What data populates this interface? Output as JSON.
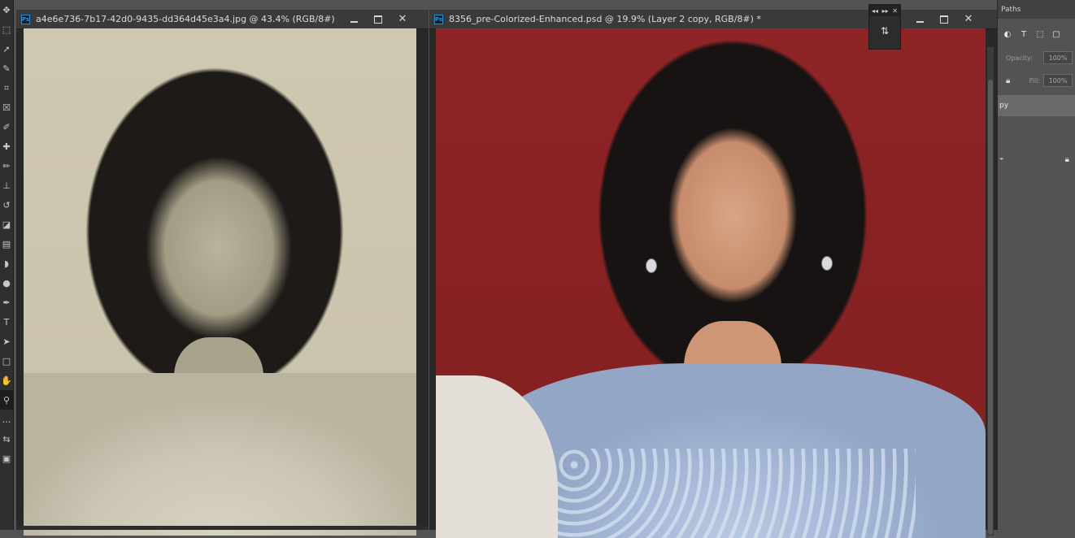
{
  "toolbar": {
    "tools": [
      {
        "name": "move-tool-icon",
        "glyph": "✥"
      },
      {
        "name": "marquee-tool-icon",
        "glyph": "⬚"
      },
      {
        "name": "lasso-tool-icon",
        "glyph": "➚"
      },
      {
        "name": "quick-select-tool-icon",
        "glyph": "✎"
      },
      {
        "name": "crop-tool-icon",
        "glyph": "⌗"
      },
      {
        "name": "frame-tool-icon",
        "glyph": "☒"
      },
      {
        "name": "eyedropper-tool-icon",
        "glyph": "✐"
      },
      {
        "name": "healing-brush-tool-icon",
        "glyph": "✚"
      },
      {
        "name": "brush-tool-icon",
        "glyph": "✏"
      },
      {
        "name": "clone-stamp-tool-icon",
        "glyph": "⊥"
      },
      {
        "name": "history-brush-tool-icon",
        "glyph": "↺"
      },
      {
        "name": "eraser-tool-icon",
        "glyph": "◪"
      },
      {
        "name": "gradient-tool-icon",
        "glyph": "▤"
      },
      {
        "name": "blur-tool-icon",
        "glyph": "◗"
      },
      {
        "name": "dodge-tool-icon",
        "glyph": "●"
      },
      {
        "name": "pen-tool-icon",
        "glyph": "✒"
      },
      {
        "name": "type-tool-icon",
        "glyph": "T"
      },
      {
        "name": "path-select-tool-icon",
        "glyph": "➤"
      },
      {
        "name": "shape-tool-icon",
        "glyph": "□"
      },
      {
        "name": "hand-tool-icon",
        "glyph": "✋"
      },
      {
        "name": "zoom-tool-icon",
        "glyph": "⚲"
      },
      {
        "name": "more-tools-icon",
        "glyph": "…"
      },
      {
        "name": "swap-colors-icon",
        "glyph": "⇆"
      },
      {
        "name": "color-swatches-icon",
        "glyph": "▣"
      }
    ],
    "active_index": 20
  },
  "documents": {
    "left": {
      "title": "a4e6e736-7b17-42d0-9435-dd364d45e3a4.jpg @ 43.4% (RGB/8#)"
    },
    "right": {
      "title": "8356_pre-Colorized-Enhanced.psd @ 19.9% (Layer 2 copy, RGB/8#) *"
    }
  },
  "window_controls": {
    "minimize": "—",
    "maximize": "□",
    "close": "✕"
  },
  "float_panel": {
    "collapse": "◂◂",
    "expand": "▸▸",
    "close": "✕",
    "history_glyph": "⇅"
  },
  "side_panel": {
    "tab_label": "Paths",
    "filter_icons": [
      {
        "name": "adjustment-filter-icon",
        "glyph": "◐"
      },
      {
        "name": "type-filter-icon",
        "glyph": "T"
      },
      {
        "name": "shape-filter-icon",
        "glyph": "⬚"
      },
      {
        "name": "smart-object-filter-icon",
        "glyph": "▢"
      }
    ],
    "opacity_label": "Opacity:",
    "opacity_value": "100%",
    "fill_label": "Fill:",
    "fill_value": "100%",
    "selected_layer_label": "py"
  }
}
